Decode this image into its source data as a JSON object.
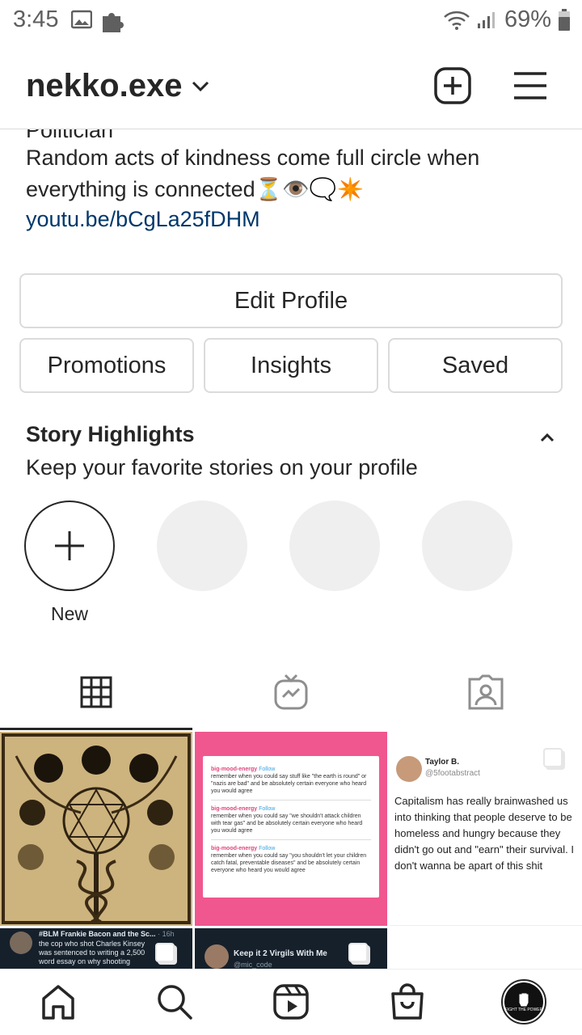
{
  "status_bar": {
    "time": "3:45",
    "battery": "69%"
  },
  "header": {
    "username": "nekko.exe"
  },
  "bio": {
    "category_partial": "Politician",
    "text": "Random acts of kindness come full circle when everything is connected⏳👁️🗨️✴️",
    "link": "youtu.be/bCgLa25fDHM"
  },
  "buttons": {
    "edit_profile": "Edit Profile",
    "promotions": "Promotions",
    "insights": "Insights",
    "saved": "Saved"
  },
  "highlights": {
    "title": "Story Highlights",
    "subtitle": "Keep your favorite stories on your profile",
    "new_label": "New"
  },
  "posts": {
    "tile2": {
      "rows": [
        {
          "handle": "big-mood-energy",
          "follow": "Follow",
          "text": "remember when you could say stuff like \"the earth is round\" or \"nazis are bad\" and be absolutely certain everyone who heard you would agree"
        },
        {
          "handle": "big-mood-energy",
          "follow": "Follow",
          "text": "remember when you could say \"we shouldn't attack children with tear gas\" and be absolutely certain everyone who heard you would agree"
        },
        {
          "handle": "big-mood-energy",
          "follow": "Follow",
          "text": "remember when you could say \"you shouldn't let your children catch fatal, preventable diseases\" and be absolutely certain everyone who heard you would agree"
        }
      ]
    },
    "tile3": {
      "name": "Taylor B.",
      "handle": "@5footabstract",
      "text": "Capitalism has really brainwashed us into thinking that people deserve to be homeless and hungry because they didn't go out and \"earn\" their survival. I don't wanna be apart of this shit"
    },
    "tile4": {
      "title": "#BLM Frankie Bacon and the Sc...",
      "time": "16h",
      "text": "the cop who shot Charles Kinsey was sentenced to writing a 2,500 word essay on why shooting people is bad and..."
    },
    "tile5": {
      "title": "Keep it 2 Virgils With Me",
      "handle": "@mic_code"
    }
  },
  "bottom_nav": {
    "avatar_text": "FIGHT THE POWER"
  }
}
